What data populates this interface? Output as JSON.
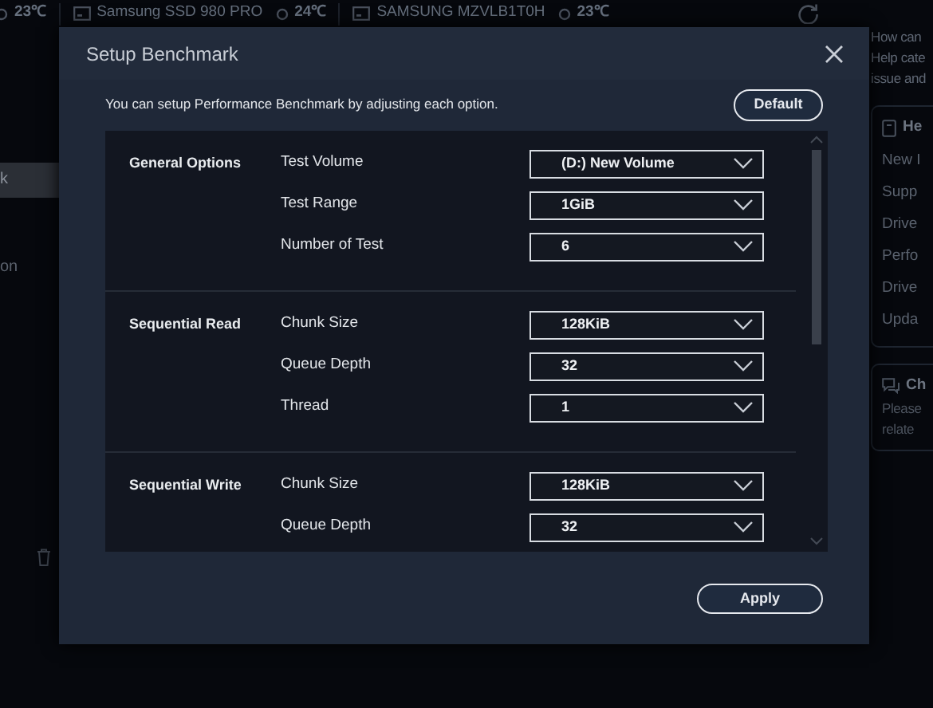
{
  "background": {
    "top_bar": [
      {
        "kind": "temp",
        "text": "23℃"
      },
      {
        "kind": "drive",
        "text": "Samsung SSD 980 PRO"
      },
      {
        "kind": "temp",
        "text": "24℃"
      },
      {
        "kind": "drive",
        "text": "SAMSUNG MZVLB1T0H"
      },
      {
        "kind": "temp",
        "text": "23℃"
      }
    ],
    "sidebar": {
      "items": [
        {
          "label": "k",
          "selected": true
        },
        {
          "label": "on",
          "selected": false
        }
      ]
    },
    "right_panel": {
      "question_lines": [
        "How can",
        "Help cate",
        "issue and"
      ],
      "help_card": {
        "title": "He",
        "items": [
          "New I",
          "Supp",
          "Drive",
          "Perfo",
          "Drive",
          "Upda"
        ]
      },
      "chat_card": {
        "title": "Ch",
        "lines": [
          "Please",
          "relate"
        ]
      }
    }
  },
  "dialog": {
    "title": "Setup Benchmark",
    "intro": "You can setup Performance Benchmark by adjusting each option.",
    "default_button": "Default",
    "sections": [
      {
        "title": "General Options",
        "options": [
          {
            "label": "Test Volume",
            "value": "(D:) New Volume"
          },
          {
            "label": "Test Range",
            "value": "1GiB"
          },
          {
            "label": "Number of Test",
            "value": "6"
          }
        ]
      },
      {
        "title": "Sequential Read",
        "options": [
          {
            "label": "Chunk Size",
            "value": "128KiB"
          },
          {
            "label": "Queue Depth",
            "value": "32"
          },
          {
            "label": "Thread",
            "value": "1"
          }
        ]
      },
      {
        "title": "Sequential Write",
        "options": [
          {
            "label": "Chunk Size",
            "value": "128KiB"
          },
          {
            "label": "Queue Depth",
            "value": "32"
          }
        ]
      }
    ],
    "apply_button": "Apply"
  }
}
